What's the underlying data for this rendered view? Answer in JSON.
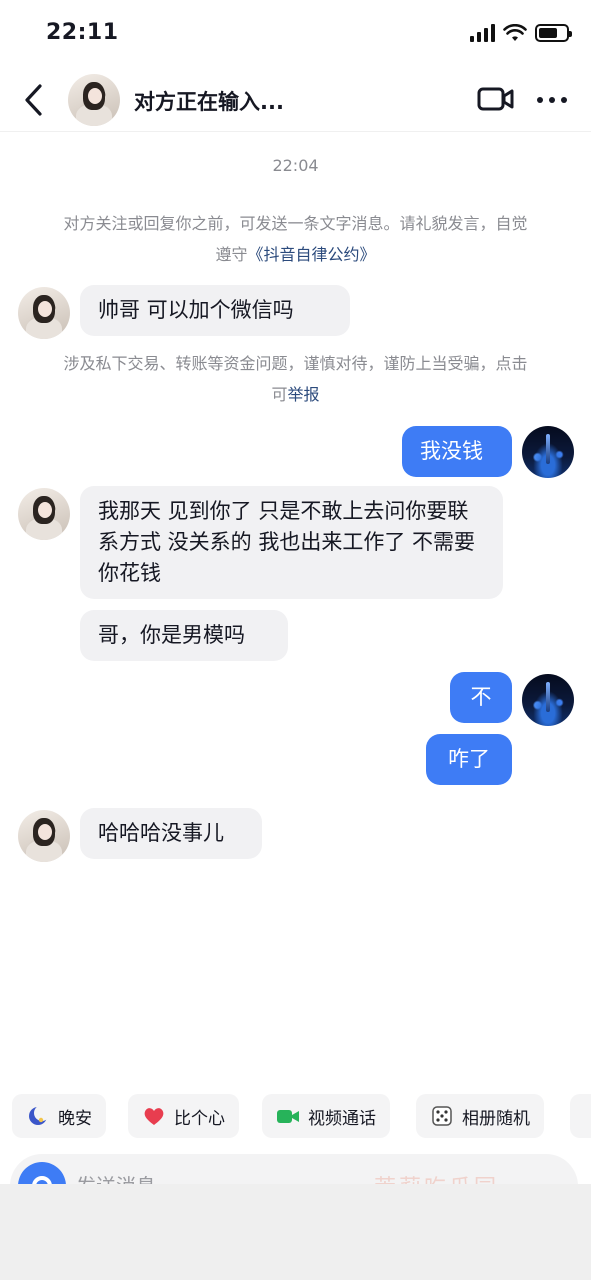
{
  "status_bar": {
    "time": "22:11"
  },
  "header": {
    "title": "对方正在输入..."
  },
  "chat": {
    "timestamp": "22:04",
    "notice_1": {
      "text": "对方关注或回复你之前，可发送一条文字消息。请礼貌发言，自觉遵守",
      "link": "《抖音自律公约》"
    },
    "messages": [
      {
        "text": "帅哥  可以加个微信吗"
      },
      {
        "text": "我没钱"
      },
      {
        "text": "我那天  见到你了  只是不敢上去问你要联系方式  没关系的 我也出来工作了 不需要你花钱"
      },
      {
        "text": "哥，你是男模吗"
      },
      {
        "text": "不"
      },
      {
        "text": "咋了"
      },
      {
        "text": "哈哈哈没事儿"
      }
    ],
    "notice_2": {
      "text": "涉及私下交易、转账等资金问题，谨慎对待，谨防上当受骗，点击可",
      "link": "举报"
    }
  },
  "quick_replies": [
    {
      "label": "晚安",
      "icon": "moon-icon"
    },
    {
      "label": "比个心",
      "icon": "heart-icon"
    },
    {
      "label": "视频通话",
      "icon": "video-call-icon"
    },
    {
      "label": "相册随机",
      "icon": "dice-icon"
    }
  ],
  "input": {
    "placeholder": "发送消息",
    "watermark": "茉莉吃瓜园"
  },
  "colors": {
    "accent": "#3e7cf5",
    "bubble_in": "#f1f1f3",
    "notice_link": "#2b4a7c"
  }
}
